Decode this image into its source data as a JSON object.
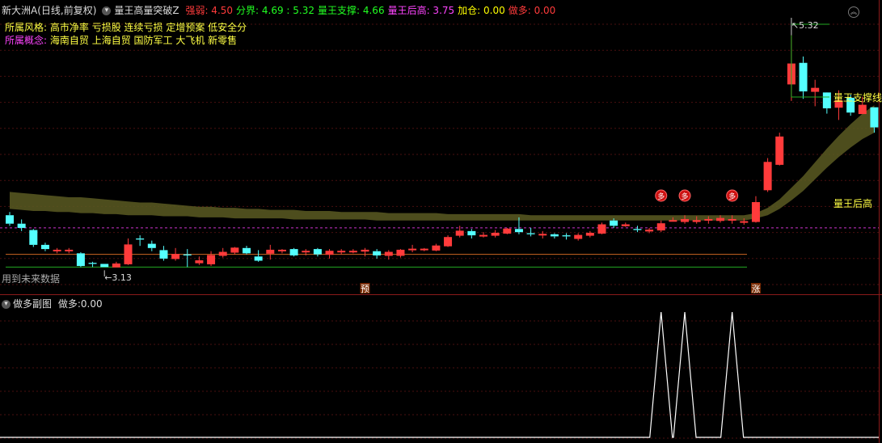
{
  "header": {
    "stock": "新大洲A(日线,前复权)",
    "indicator": "量王高量突破Z",
    "items": [
      {
        "label": "强弱:",
        "value": "4.50",
        "color": "#ff3b3b"
      },
      {
        "label": "分界:",
        "value": "4.69 : 5.32",
        "color": "#22ff22"
      },
      {
        "label": "量王支撑:",
        "value": "4.66",
        "color": "#22ff22"
      },
      {
        "label": "量王后高:",
        "value": "3.75",
        "color": "#ff44ff"
      },
      {
        "label": "加仓:",
        "value": "0.00",
        "color": "#ffff00"
      },
      {
        "label": "做多:",
        "value": "0.00",
        "color": "#ff3b3b"
      }
    ]
  },
  "info": {
    "style_label": "所属风格:",
    "style_value": "高市净率 亏损股 连续亏损 定增预案 低安全分",
    "concept_label": "所属概念:",
    "concept_value": "海南自贸 上海自贸 国防军工 大飞机 新零售"
  },
  "labels": {
    "future_data": "用到未来数据",
    "support_line": "量王支撑线",
    "rear_high": "量王后高",
    "low_mark": "3.13",
    "high_mark": "5.32",
    "pre_marker": "预",
    "rise_marker": "涨",
    "buy_marker": "多"
  },
  "sub_panel": {
    "title": "做多副图",
    "value_label": "做多:",
    "value": "0.00"
  },
  "colors": {
    "up": "#ff3b3b",
    "down": "#54ffff",
    "band": "#5a5a22",
    "support": "#b0b000"
  },
  "chart_data": {
    "type": "candlestick",
    "ylim": [
      2.98,
      5.44
    ],
    "candles": [
      [
        3.62,
        3.54,
        3.65,
        3.52
      ],
      [
        3.54,
        3.5,
        3.58,
        3.47
      ],
      [
        3.48,
        3.34,
        3.49,
        3.32
      ],
      [
        3.34,
        3.3,
        3.36,
        3.28
      ],
      [
        3.29,
        3.29,
        3.31,
        3.26
      ],
      [
        3.29,
        3.29,
        3.31,
        3.26
      ],
      [
        3.26,
        3.14,
        3.27,
        3.13
      ],
      [
        3.17,
        3.16,
        3.18,
        3.13
      ],
      [
        3.16,
        3.13,
        3.16,
        3.13
      ],
      [
        3.13,
        3.16,
        3.18,
        3.13
      ],
      [
        3.16,
        3.34,
        3.4,
        3.15
      ],
      [
        3.4,
        3.39,
        3.43,
        3.33
      ],
      [
        3.35,
        3.31,
        3.38,
        3.28
      ],
      [
        3.29,
        3.21,
        3.33,
        3.19
      ],
      [
        3.21,
        3.25,
        3.31,
        3.19
      ],
      [
        3.25,
        3.24,
        3.3,
        3.13
      ],
      [
        3.17,
        3.19,
        3.23,
        3.15
      ],
      [
        3.16,
        3.24,
        3.28,
        3.14
      ],
      [
        3.24,
        3.27,
        3.31,
        3.22
      ],
      [
        3.27,
        3.31,
        3.32,
        3.25
      ],
      [
        3.31,
        3.26,
        3.33,
        3.25
      ],
      [
        3.23,
        3.19,
        3.29,
        3.18
      ],
      [
        3.26,
        3.29,
        3.34,
        3.2
      ],
      [
        3.29,
        3.29,
        3.3,
        3.26
      ],
      [
        3.3,
        3.24,
        3.31,
        3.23
      ],
      [
        3.28,
        3.28,
        3.3,
        3.24
      ],
      [
        3.3,
        3.25,
        3.31,
        3.23
      ],
      [
        3.25,
        3.28,
        3.3,
        3.21
      ],
      [
        3.28,
        3.28,
        3.3,
        3.25
      ],
      [
        3.28,
        3.28,
        3.3,
        3.26
      ],
      [
        3.28,
        3.29,
        3.31,
        3.23
      ],
      [
        3.28,
        3.24,
        3.3,
        3.21
      ],
      [
        3.24,
        3.27,
        3.29,
        3.2
      ],
      [
        3.24,
        3.29,
        3.3,
        3.22
      ],
      [
        3.3,
        3.3,
        3.34,
        3.27
      ],
      [
        3.3,
        3.3,
        3.31,
        3.28
      ],
      [
        3.29,
        3.33,
        3.35,
        3.28
      ],
      [
        3.33,
        3.41,
        3.43,
        3.32
      ],
      [
        3.43,
        3.47,
        3.52,
        3.41
      ],
      [
        3.47,
        3.43,
        3.49,
        3.4
      ],
      [
        3.43,
        3.43,
        3.46,
        3.41
      ],
      [
        3.43,
        3.45,
        3.48,
        3.41
      ],
      [
        3.45,
        3.49,
        3.5,
        3.44
      ],
      [
        3.49,
        3.46,
        3.6,
        3.44
      ],
      [
        3.45,
        3.44,
        3.5,
        3.42
      ],
      [
        3.44,
        3.44,
        3.47,
        3.4
      ],
      [
        3.44,
        3.42,
        3.45,
        3.4
      ],
      [
        3.43,
        3.42,
        3.45,
        3.39
      ],
      [
        3.4,
        3.43,
        3.45,
        3.38
      ],
      [
        3.43,
        3.45,
        3.47,
        3.41
      ],
      [
        3.45,
        3.53,
        3.55,
        3.44
      ],
      [
        3.57,
        3.52,
        3.59,
        3.5
      ],
      [
        3.52,
        3.53,
        3.55,
        3.51
      ],
      [
        3.49,
        3.48,
        3.52,
        3.46
      ],
      [
        3.47,
        3.48,
        3.5,
        3.45
      ],
      [
        3.48,
        3.54,
        3.57,
        3.46
      ],
      [
        3.57,
        3.57,
        3.6,
        3.56
      ],
      [
        3.56,
        3.58,
        3.62,
        3.54
      ],
      [
        3.56,
        3.57,
        3.61,
        3.54
      ],
      [
        3.58,
        3.58,
        3.61,
        3.54
      ],
      [
        3.57,
        3.59,
        3.62,
        3.55
      ],
      [
        3.58,
        3.58,
        3.62,
        3.54
      ],
      [
        3.56,
        3.56,
        3.59,
        3.53
      ],
      [
        3.56,
        3.74,
        3.8,
        3.55
      ],
      [
        3.86,
        4.12,
        4.16,
        3.84
      ],
      [
        4.1,
        4.36,
        4.4,
        4.09
      ],
      [
        4.86,
        5.05,
        5.32,
        4.7
      ],
      [
        5.06,
        4.79,
        5.12,
        4.72
      ],
      [
        4.79,
        4.82,
        4.9,
        4.65
      ],
      [
        4.78,
        4.63,
        4.77,
        4.58
      ],
      [
        4.64,
        4.7,
        4.8,
        4.52
      ],
      [
        4.73,
        4.59,
        4.76,
        4.56
      ],
      [
        4.58,
        4.66,
        4.74,
        4.58
      ],
      [
        4.64,
        4.45,
        4.64,
        4.4
      ]
    ],
    "support_band": {
      "top": [
        3.84,
        3.83,
        3.82,
        3.81,
        3.8,
        3.79,
        3.79,
        3.78,
        3.77,
        3.76,
        3.75,
        3.74,
        3.74,
        3.73,
        3.72,
        3.71,
        3.7,
        3.7,
        3.69,
        3.69,
        3.68,
        3.68,
        3.67,
        3.67,
        3.67,
        3.66,
        3.66,
        3.66,
        3.65,
        3.65,
        3.65,
        3.65,
        3.64,
        3.64,
        3.64,
        3.64,
        3.64,
        3.63,
        3.63,
        3.63,
        3.63,
        3.63,
        3.63,
        3.63,
        3.62,
        3.62,
        3.62,
        3.62,
        3.62,
        3.62,
        3.62,
        3.62,
        3.62,
        3.62,
        3.62,
        3.62,
        3.62,
        3.62,
        3.62,
        3.62,
        3.62,
        3.62,
        3.62,
        3.64,
        3.69,
        3.77,
        3.88,
        3.99,
        4.12,
        4.25,
        4.37,
        4.48,
        4.58,
        4.66
      ],
      "bottom": [
        3.68,
        3.67,
        3.66,
        3.66,
        3.65,
        3.65,
        3.64,
        3.64,
        3.63,
        3.63,
        3.62,
        3.62,
        3.62,
        3.61,
        3.61,
        3.61,
        3.6,
        3.6,
        3.6,
        3.59,
        3.59,
        3.59,
        3.59,
        3.59,
        3.58,
        3.58,
        3.58,
        3.58,
        3.58,
        3.58,
        3.58,
        3.57,
        3.57,
        3.57,
        3.57,
        3.57,
        3.57,
        3.57,
        3.57,
        3.57,
        3.57,
        3.57,
        3.57,
        3.57,
        3.57,
        3.57,
        3.57,
        3.57,
        3.57,
        3.57,
        3.57,
        3.57,
        3.57,
        3.57,
        3.57,
        3.57,
        3.57,
        3.57,
        3.57,
        3.57,
        3.57,
        3.57,
        3.57,
        3.59,
        3.62,
        3.68,
        3.76,
        3.85,
        3.96,
        4.07,
        4.17,
        4.26,
        4.34,
        4.4
      ]
    },
    "rear_high_value": 3.5,
    "orange_level": 3.25,
    "green_level": 3.13,
    "buy_signals": [
      55,
      57,
      61
    ],
    "sub_signal_spikes": [
      55,
      57,
      61
    ]
  }
}
